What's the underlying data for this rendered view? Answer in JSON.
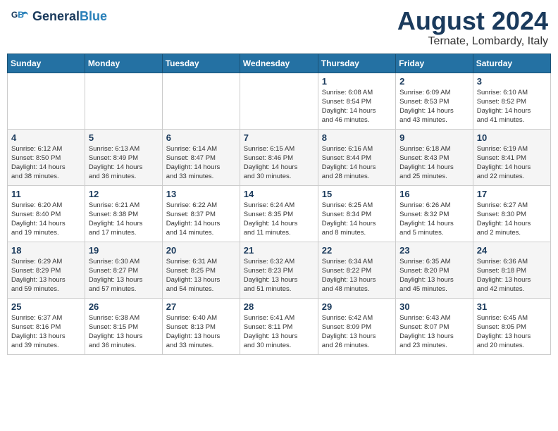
{
  "logo": {
    "line1": "General",
    "line2": "Blue"
  },
  "title": "August 2024",
  "subtitle": "Ternate, Lombardy, Italy",
  "days_header": [
    "Sunday",
    "Monday",
    "Tuesday",
    "Wednesday",
    "Thursday",
    "Friday",
    "Saturday"
  ],
  "weeks": [
    [
      {
        "num": "",
        "info": ""
      },
      {
        "num": "",
        "info": ""
      },
      {
        "num": "",
        "info": ""
      },
      {
        "num": "",
        "info": ""
      },
      {
        "num": "1",
        "info": "Sunrise: 6:08 AM\nSunset: 8:54 PM\nDaylight: 14 hours\nand 46 minutes."
      },
      {
        "num": "2",
        "info": "Sunrise: 6:09 AM\nSunset: 8:53 PM\nDaylight: 14 hours\nand 43 minutes."
      },
      {
        "num": "3",
        "info": "Sunrise: 6:10 AM\nSunset: 8:52 PM\nDaylight: 14 hours\nand 41 minutes."
      }
    ],
    [
      {
        "num": "4",
        "info": "Sunrise: 6:12 AM\nSunset: 8:50 PM\nDaylight: 14 hours\nand 38 minutes."
      },
      {
        "num": "5",
        "info": "Sunrise: 6:13 AM\nSunset: 8:49 PM\nDaylight: 14 hours\nand 36 minutes."
      },
      {
        "num": "6",
        "info": "Sunrise: 6:14 AM\nSunset: 8:47 PM\nDaylight: 14 hours\nand 33 minutes."
      },
      {
        "num": "7",
        "info": "Sunrise: 6:15 AM\nSunset: 8:46 PM\nDaylight: 14 hours\nand 30 minutes."
      },
      {
        "num": "8",
        "info": "Sunrise: 6:16 AM\nSunset: 8:44 PM\nDaylight: 14 hours\nand 28 minutes."
      },
      {
        "num": "9",
        "info": "Sunrise: 6:18 AM\nSunset: 8:43 PM\nDaylight: 14 hours\nand 25 minutes."
      },
      {
        "num": "10",
        "info": "Sunrise: 6:19 AM\nSunset: 8:41 PM\nDaylight: 14 hours\nand 22 minutes."
      }
    ],
    [
      {
        "num": "11",
        "info": "Sunrise: 6:20 AM\nSunset: 8:40 PM\nDaylight: 14 hours\nand 19 minutes."
      },
      {
        "num": "12",
        "info": "Sunrise: 6:21 AM\nSunset: 8:38 PM\nDaylight: 14 hours\nand 17 minutes."
      },
      {
        "num": "13",
        "info": "Sunrise: 6:22 AM\nSunset: 8:37 PM\nDaylight: 14 hours\nand 14 minutes."
      },
      {
        "num": "14",
        "info": "Sunrise: 6:24 AM\nSunset: 8:35 PM\nDaylight: 14 hours\nand 11 minutes."
      },
      {
        "num": "15",
        "info": "Sunrise: 6:25 AM\nSunset: 8:34 PM\nDaylight: 14 hours\nand 8 minutes."
      },
      {
        "num": "16",
        "info": "Sunrise: 6:26 AM\nSunset: 8:32 PM\nDaylight: 14 hours\nand 5 minutes."
      },
      {
        "num": "17",
        "info": "Sunrise: 6:27 AM\nSunset: 8:30 PM\nDaylight: 14 hours\nand 2 minutes."
      }
    ],
    [
      {
        "num": "18",
        "info": "Sunrise: 6:29 AM\nSunset: 8:29 PM\nDaylight: 13 hours\nand 59 minutes."
      },
      {
        "num": "19",
        "info": "Sunrise: 6:30 AM\nSunset: 8:27 PM\nDaylight: 13 hours\nand 57 minutes."
      },
      {
        "num": "20",
        "info": "Sunrise: 6:31 AM\nSunset: 8:25 PM\nDaylight: 13 hours\nand 54 minutes."
      },
      {
        "num": "21",
        "info": "Sunrise: 6:32 AM\nSunset: 8:23 PM\nDaylight: 13 hours\nand 51 minutes."
      },
      {
        "num": "22",
        "info": "Sunrise: 6:34 AM\nSunset: 8:22 PM\nDaylight: 13 hours\nand 48 minutes."
      },
      {
        "num": "23",
        "info": "Sunrise: 6:35 AM\nSunset: 8:20 PM\nDaylight: 13 hours\nand 45 minutes."
      },
      {
        "num": "24",
        "info": "Sunrise: 6:36 AM\nSunset: 8:18 PM\nDaylight: 13 hours\nand 42 minutes."
      }
    ],
    [
      {
        "num": "25",
        "info": "Sunrise: 6:37 AM\nSunset: 8:16 PM\nDaylight: 13 hours\nand 39 minutes."
      },
      {
        "num": "26",
        "info": "Sunrise: 6:38 AM\nSunset: 8:15 PM\nDaylight: 13 hours\nand 36 minutes."
      },
      {
        "num": "27",
        "info": "Sunrise: 6:40 AM\nSunset: 8:13 PM\nDaylight: 13 hours\nand 33 minutes."
      },
      {
        "num": "28",
        "info": "Sunrise: 6:41 AM\nSunset: 8:11 PM\nDaylight: 13 hours\nand 30 minutes."
      },
      {
        "num": "29",
        "info": "Sunrise: 6:42 AM\nSunset: 8:09 PM\nDaylight: 13 hours\nand 26 minutes."
      },
      {
        "num": "30",
        "info": "Sunrise: 6:43 AM\nSunset: 8:07 PM\nDaylight: 13 hours\nand 23 minutes."
      },
      {
        "num": "31",
        "info": "Sunrise: 6:45 AM\nSunset: 8:05 PM\nDaylight: 13 hours\nand 20 minutes."
      }
    ]
  ]
}
